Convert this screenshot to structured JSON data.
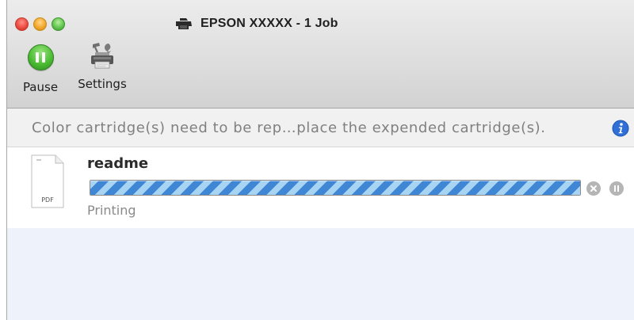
{
  "window": {
    "title": "EPSON XXXXX - 1 Job"
  },
  "toolbar": {
    "pause_label": "Pause",
    "settings_label": "Settings"
  },
  "status": {
    "message": "Color cartridge(s) need to be rep…place the expended cartridge(s).",
    "icon": "info-icon"
  },
  "jobs": [
    {
      "name": "readme",
      "file_type": "PDF",
      "status": "Printing",
      "progress": "indeterminate"
    }
  ],
  "colors": {
    "pause_green": "#4cbd34",
    "progress_blue": "#3f86d4",
    "progress_light": "#a8d4f4",
    "info_blue": "#2f6fd6",
    "alternate_row": "#eef3fb"
  }
}
